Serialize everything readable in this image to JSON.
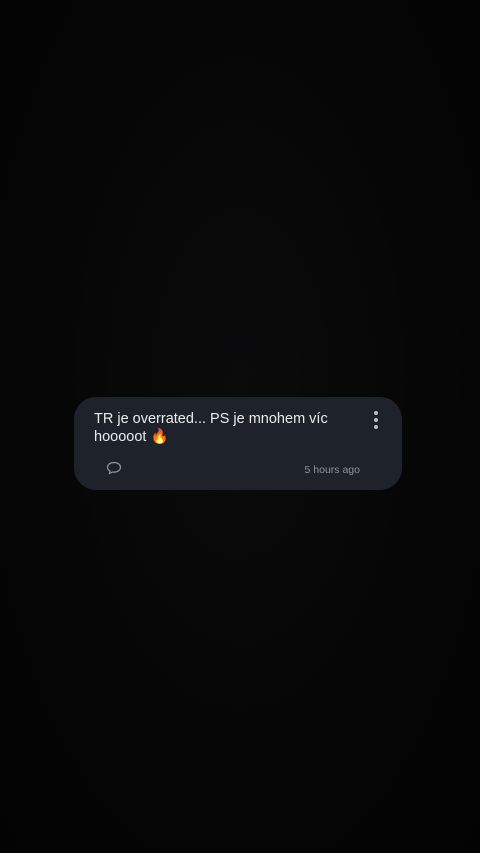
{
  "comment": {
    "text": "TR je overrated... PS je mnohem víc hooooot 🔥",
    "timestamp": "5 hours ago",
    "icons": {
      "reply": "speech-bubble-icon",
      "more": "more-vertical-icon"
    }
  },
  "colors": {
    "background": "#050505",
    "card": "#1e232b",
    "text": "#e9ebee",
    "muted": "#8e949c"
  }
}
